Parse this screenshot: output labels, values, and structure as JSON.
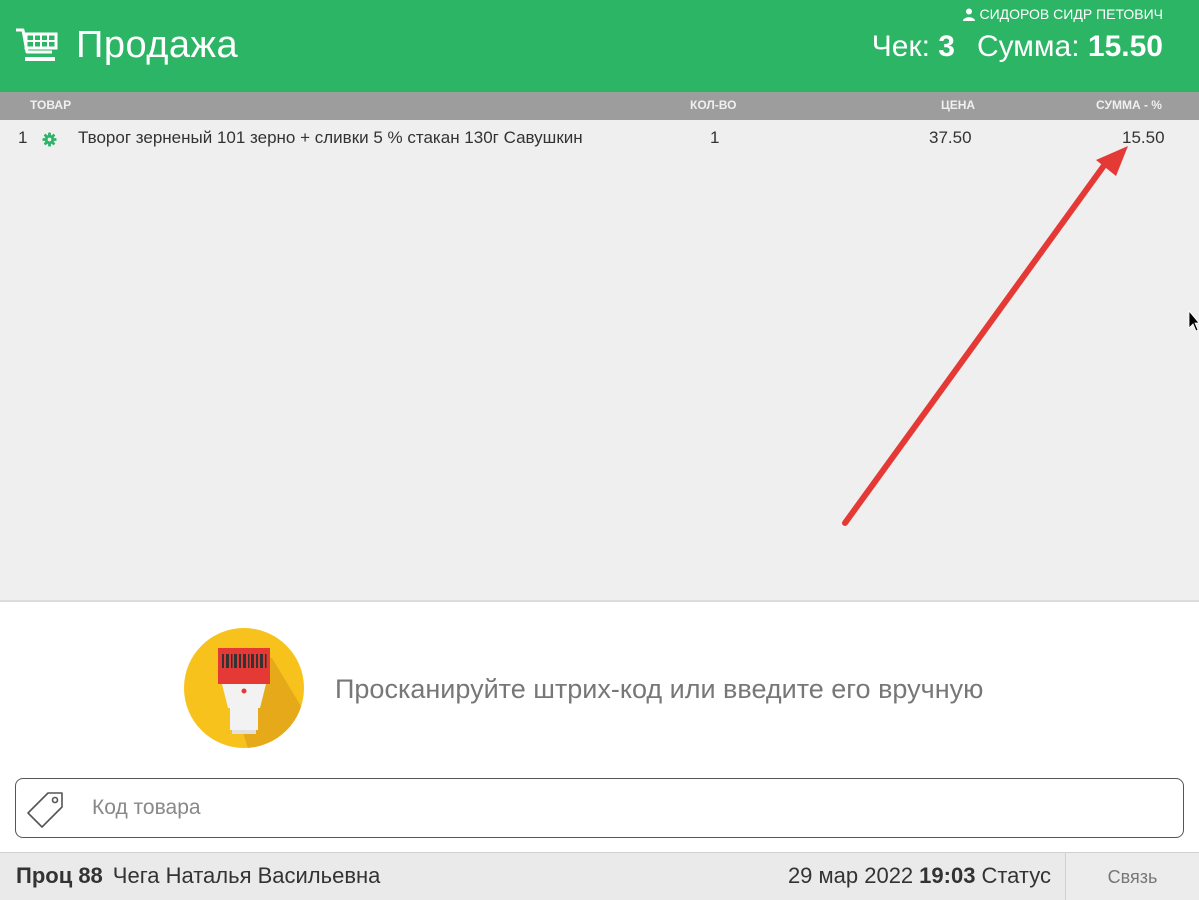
{
  "header": {
    "title": "Продажа",
    "user": "СИДОРОВ СИДР ПЕТОВИЧ",
    "check_label": "Чек:",
    "check_number": "3",
    "sum_label": "Сумма:",
    "sum_value": "15.50",
    "icon": "cart-icon",
    "user_icon": "person-icon"
  },
  "table": {
    "columns": {
      "product": "ТОВАР",
      "qty": "КОЛ-ВО",
      "price": "ЦЕНА",
      "sum": "СУММА - %"
    },
    "rows": [
      {
        "index": "1",
        "name": "Творог зерненый 101 зерно + сливки 5 % стакан 130г Савушкин",
        "qty": "1",
        "price": "37.50",
        "sum": "15.50",
        "icon": "gear-icon"
      }
    ]
  },
  "scan": {
    "prompt": "Просканируйте штрих-код или введите его вручную",
    "icon": "barcode-scanner-icon"
  },
  "input": {
    "placeholder": "Код товара",
    "value": "",
    "icon": "tag-icon"
  },
  "footer": {
    "proc_label": "Проц 88",
    "cashier": "Чега Наталья Васильевна",
    "date": "29 мар 2022",
    "time": "19:03",
    "status": "Статус",
    "link_label": "Связь"
  },
  "colors": {
    "header_bg": "#2bb565",
    "table_header_bg": "#9d9d9d",
    "body_bg": "#efefef",
    "annotation_arrow": "#e53935",
    "scanner_circle": "#f7c21b"
  }
}
